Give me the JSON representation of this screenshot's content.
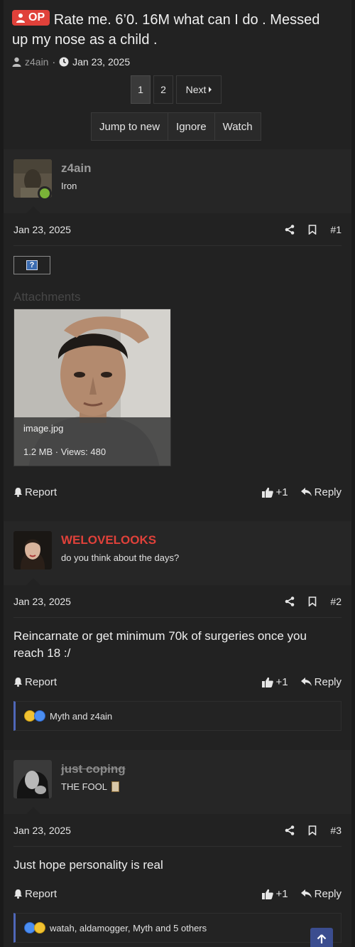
{
  "thread": {
    "op_badge": "OP",
    "title": "Rate me. 6’0. 16M what can I do . Messed up my nose as a child .",
    "author": "z4ain",
    "date": "Jan 23, 2025"
  },
  "pagination": {
    "pages": [
      "1",
      "2"
    ],
    "current": "1",
    "next_label": "Next"
  },
  "thread_actions": {
    "jump": "Jump to new",
    "ignore": "Ignore",
    "watch": "Watch"
  },
  "posts": [
    {
      "username": "z4ain",
      "username_color": "#9a9a9a",
      "user_title": "Iron",
      "online": true,
      "date": "Jan 23, 2025",
      "number": "#1",
      "attachments_label": "Attachments",
      "attachment": {
        "name": "image.jpg",
        "size": "1.2 MB · Views: 480"
      },
      "report": "Report",
      "like": "+1",
      "reply": "Reply"
    },
    {
      "username": "WELOVELOOKS",
      "username_color": "#e0413a",
      "user_title": "do you think about the days?",
      "date": "Jan 23, 2025",
      "number": "#2",
      "body": "Reincarnate or get minimum 70k of surgeries once you reach 18 :/",
      "report": "Report",
      "like": "+1",
      "reply": "Reply",
      "reactions": "Myth and z4ain"
    },
    {
      "username": "just coping",
      "username_color": "#8a8a8a",
      "user_title": "THE FOOL",
      "date": "Jan 23, 2025",
      "number": "#3",
      "body": "Just hope personality is real",
      "report": "Report",
      "like": "+1",
      "reply": "Reply",
      "reactions": "watah, aldamogger, Myth and 5 others"
    }
  ],
  "icons": [
    "user-icon",
    "clock-icon",
    "share-icon",
    "bookmark-icon",
    "bell-icon",
    "thumbs-up-icon",
    "reply-icon",
    "arrow-up-icon"
  ],
  "colors": {
    "accent": "#e0413a",
    "online": "#7ab338",
    "reaction_bar": "#4f67b8"
  }
}
